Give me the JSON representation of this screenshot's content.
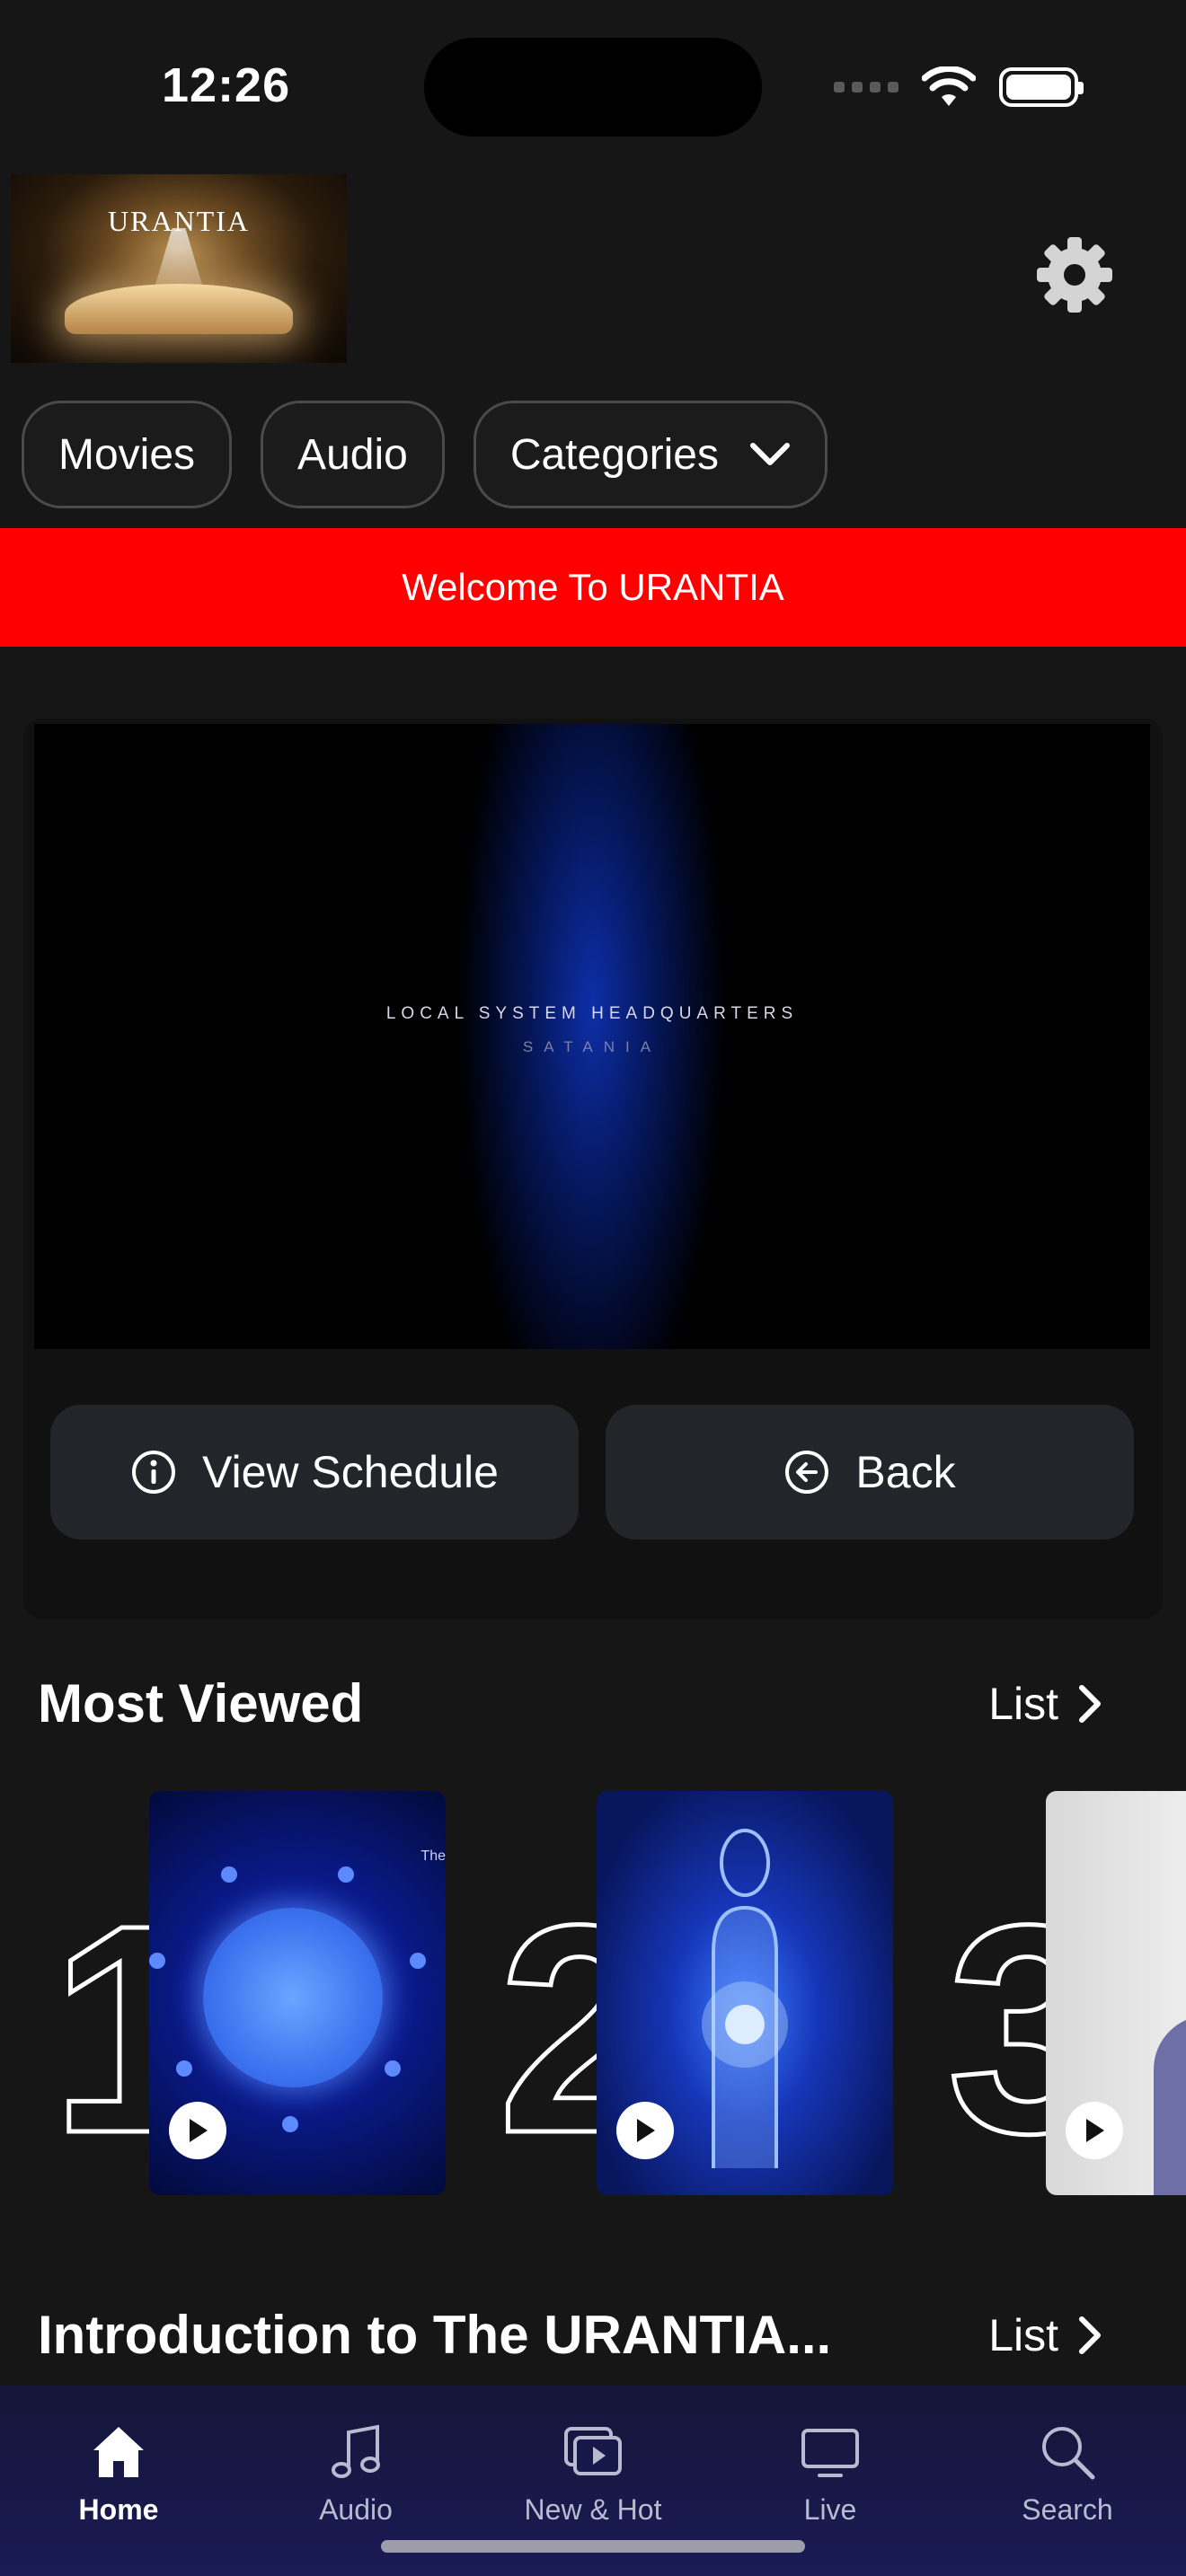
{
  "status_bar": {
    "time": "12:26"
  },
  "header": {
    "logo_text": "URANTIA"
  },
  "chips": [
    {
      "label": "Movies"
    },
    {
      "label": "Audio"
    },
    {
      "label": "Categories"
    }
  ],
  "banner": {
    "text": "Welcome To URANTIA"
  },
  "player": {
    "video_title": "LOCAL SYSTEM HEADQUARTERS",
    "video_subtitle": "SATANIA",
    "view_schedule_label": "View Schedule",
    "back_label": "Back"
  },
  "most_viewed": {
    "title": "Most Viewed",
    "list_label": "List",
    "items": [
      {
        "rank": "1",
        "poster_tag": "The"
      },
      {
        "rank": "2"
      },
      {
        "rank": "3"
      }
    ]
  },
  "intro_section": {
    "title": "Introduction to The URANTIA...",
    "list_label": "List"
  },
  "tabbar": {
    "items": [
      {
        "label": "Home",
        "icon": "home-icon",
        "active": true
      },
      {
        "label": "Audio",
        "icon": "music-note-icon"
      },
      {
        "label": "New & Hot",
        "icon": "play-stack-icon"
      },
      {
        "label": "Live",
        "icon": "tv-icon"
      },
      {
        "label": "Search",
        "icon": "search-icon"
      }
    ]
  },
  "colors": {
    "banner": "#ff0000",
    "background": "#161616",
    "card": "#111111",
    "button": "#23252a"
  }
}
